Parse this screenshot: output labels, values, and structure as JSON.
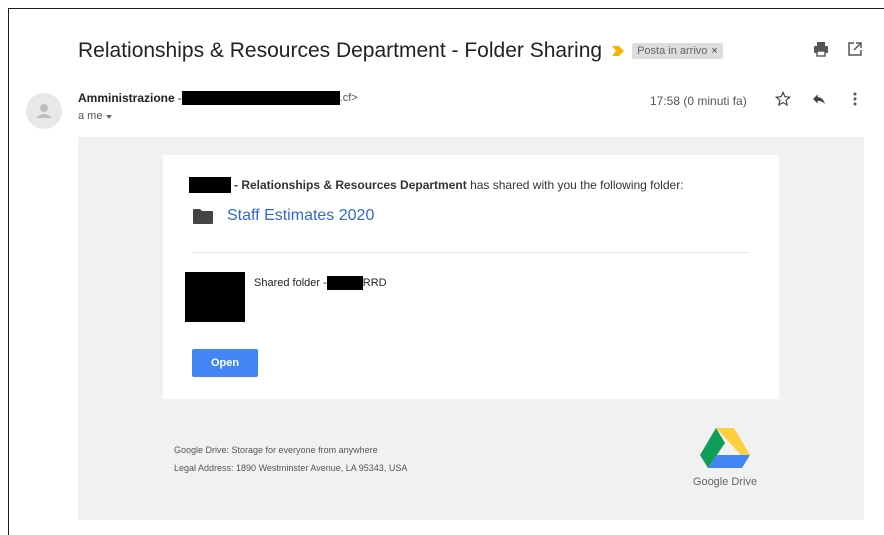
{
  "email": {
    "subject": "Relationships & Resources Department - Folder Sharing",
    "label": "Posta in arrivo",
    "label_remove": "×",
    "sender_name": "Amministrazione",
    "sender_domain_suffix": ".cf>",
    "recipient": "a me",
    "time": "17:58 (0 minuti fa)"
  },
  "body": {
    "share_org": "- Relationships & Resources Department",
    "share_text": " has shared with you the following folder:",
    "folder_name": "Staff Estimates 2020",
    "shared_folder_prefix": "Shared folder -",
    "shared_folder_suffix": "RRD",
    "open_button": "Open"
  },
  "footer": {
    "line1": "Google Drive: Storage for everyone from anywhere",
    "line2": "Legal Address: 1890 Westminster Avenue, LA 95343, USA",
    "brand": "Google Drive"
  },
  "colors": {
    "link": "#3367d6",
    "button": "#4285f4",
    "importance": "#f4b400"
  },
  "icons": [
    "importance-marker-icon",
    "print-icon",
    "open-in-new-window-icon",
    "avatar-icon",
    "star-icon",
    "reply-icon",
    "more-vertical-icon",
    "folder-icon",
    "google-drive-logo"
  ]
}
